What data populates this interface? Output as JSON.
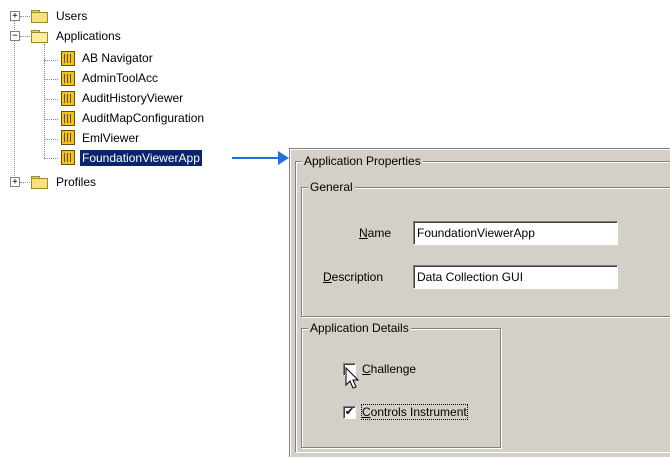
{
  "tree": {
    "items": [
      {
        "label": "Users",
        "expander": "+",
        "icon": "folder-icon"
      },
      {
        "label": "Applications",
        "expander": "−",
        "icon": "folder-open-icon"
      },
      {
        "label": "AB Navigator",
        "icon": "application-icon"
      },
      {
        "label": "AdminToolAcc",
        "icon": "application-icon"
      },
      {
        "label": "AuditHistoryViewer",
        "icon": "application-icon"
      },
      {
        "label": "AuditMapConfiguration",
        "icon": "application-icon"
      },
      {
        "label": "EmlViewer",
        "icon": "application-icon"
      },
      {
        "label": "FoundationViewerApp",
        "icon": "application-icon",
        "selected": true
      },
      {
        "label": "Profiles",
        "expander": "+",
        "icon": "folder-icon"
      }
    ]
  },
  "arrow_color": "#1f6fe0",
  "panel": {
    "title": "Application Properties",
    "general": {
      "title": "General",
      "name_label": "Name",
      "name_value": "FoundationViewerApp",
      "description_label": "Description",
      "description_value": "Data Collection GUI"
    },
    "details": {
      "title": "Application Details",
      "challenge_label": "Challenge",
      "challenge_checked": false,
      "controls_label": "Controls Instrument",
      "controls_checked": true
    }
  },
  "colors": {
    "selection": "#0a246a",
    "panel_bg": "#d4d0c8"
  }
}
